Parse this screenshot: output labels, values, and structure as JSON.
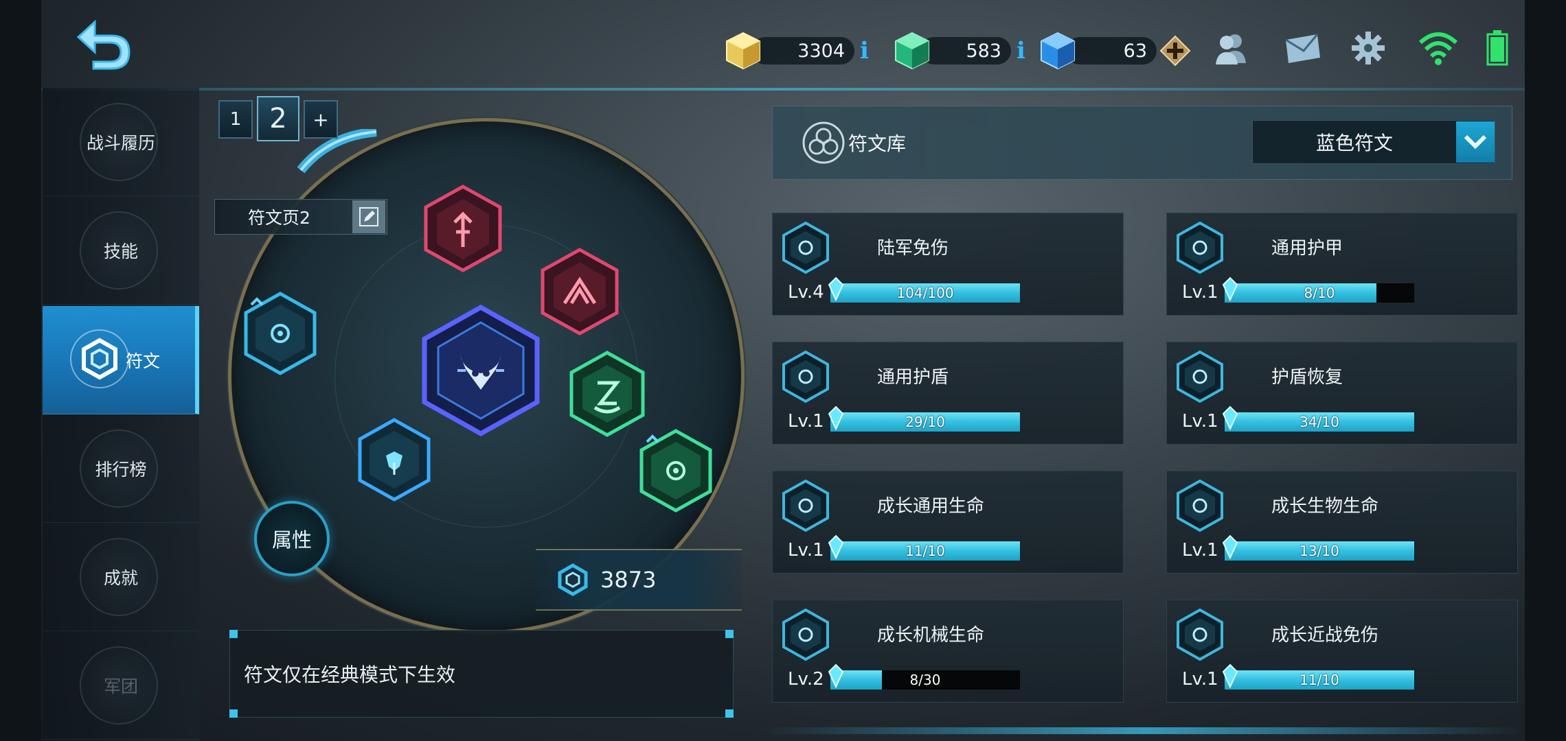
{
  "resources": {
    "gold": {
      "value": "3304",
      "icon": "gold-cube-icon"
    },
    "emerald": {
      "value": "583",
      "icon": "emerald-gem-icon"
    },
    "diamond": {
      "value": "63",
      "icon": "blue-diamond-icon"
    },
    "info_glyph": "i",
    "accent": "#35b9ff"
  },
  "top_icons": [
    "friends-icon",
    "mail-icon",
    "settings-gear-icon",
    "wifi-icon",
    "battery-icon"
  ],
  "sidebar": {
    "items": [
      {
        "label": "战斗履历",
        "active": false
      },
      {
        "label": "技能",
        "active": false
      },
      {
        "label": "符文",
        "active": true
      },
      {
        "label": "排行榜",
        "active": false
      },
      {
        "label": "成就",
        "active": false
      },
      {
        "label": "军团",
        "active": false
      }
    ]
  },
  "rune_page": {
    "tabs": [
      "1",
      "2",
      "+"
    ],
    "selected_tab": "2",
    "page_name": "符文页2",
    "attributes_button": "属性",
    "points": "3873",
    "notice": "符文仅在经典模式下生效"
  },
  "library": {
    "title": "符文库",
    "filter": "蓝色符文",
    "cards": [
      {
        "name": "陆军免伤",
        "level": "Lv.4",
        "progress": "104/100",
        "fill": 1.0,
        "icon": "army-shield-rune-icon"
      },
      {
        "name": "通用护甲",
        "level": "Lv.1",
        "progress": "8/10",
        "fill": 0.8,
        "icon": "armor-rune-icon"
      },
      {
        "name": "通用护盾",
        "level": "Lv.1",
        "progress": "29/10",
        "fill": 1.0,
        "icon": "shield-rune-icon"
      },
      {
        "name": "护盾恢复",
        "level": "Lv.1",
        "progress": "34/10",
        "fill": 1.0,
        "icon": "shield-regen-rune-icon"
      },
      {
        "name": "成长通用生命",
        "level": "Lv.1",
        "progress": "11/10",
        "fill": 1.0,
        "icon": "growth-life-rune-icon"
      },
      {
        "name": "成长生物生命",
        "level": "Lv.1",
        "progress": "13/10",
        "fill": 1.0,
        "icon": "growth-bio-life-rune-icon"
      },
      {
        "name": "成长机械生命",
        "level": "Lv.2",
        "progress": "8/30",
        "fill": 0.27,
        "icon": "growth-mech-life-rune-icon"
      },
      {
        "name": "成长近战免伤",
        "level": "Lv.1",
        "progress": "11/10",
        "fill": 1.0,
        "icon": "growth-melee-rune-icon"
      }
    ]
  },
  "colors": {
    "bar_fill": "#34bfe0",
    "active_tab": "#1f8fd0",
    "red_rune": "#d2345a",
    "green_rune": "#2fcf88",
    "blue_rune": "#2a86e0"
  }
}
